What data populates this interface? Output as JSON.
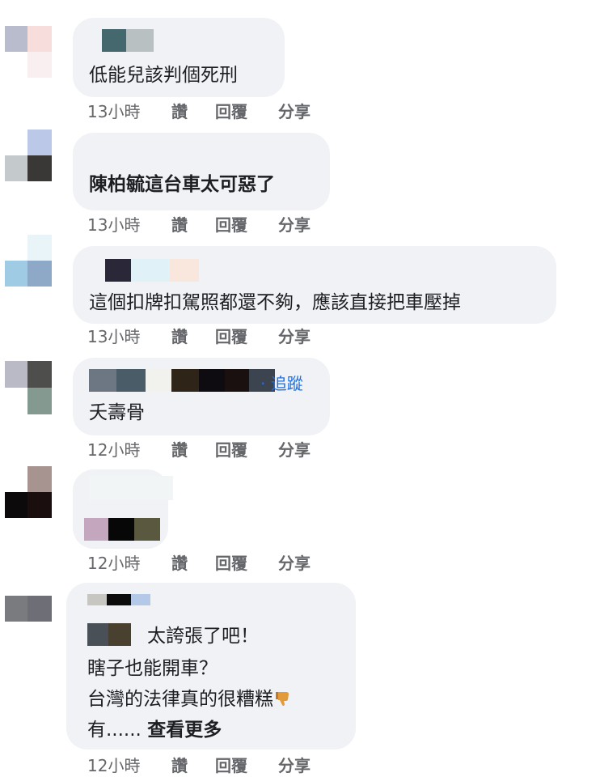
{
  "actions": {
    "like_label": "讚",
    "reply_label": "回覆",
    "share_label": "分享"
  },
  "comments": [
    {
      "time": "13小時",
      "text_lines": [
        "低能兒該判個死刑"
      ]
    },
    {
      "time": "13小時",
      "text_lines": [
        "陳柏毓這台車太可惡了"
      ]
    },
    {
      "time": "13小時",
      "text_lines": [
        "這個扣牌扣駕照都還不夠，應該直接把車壓掉"
      ]
    },
    {
      "time": "12小時",
      "follow_label": "· 追蹤",
      "text_lines": [
        "夭壽骨"
      ]
    },
    {
      "time": "12小時",
      "text_lines": []
    },
    {
      "time": "12小時",
      "name_partial": "阿   康",
      "text_lines": [
        "太誇張了吧！",
        "瞎子也能開車？",
        "台灣的法律真的很糟糕",
        "有......"
      ],
      "see_more_label": "查看更多",
      "emoji": "thumbs-down-icon"
    }
  ],
  "colors": {
    "bubble_bg": "#f0f2f5",
    "meta_text": "#65676b",
    "link_blue": "#216fdb",
    "body_text": "#1c1e21"
  }
}
